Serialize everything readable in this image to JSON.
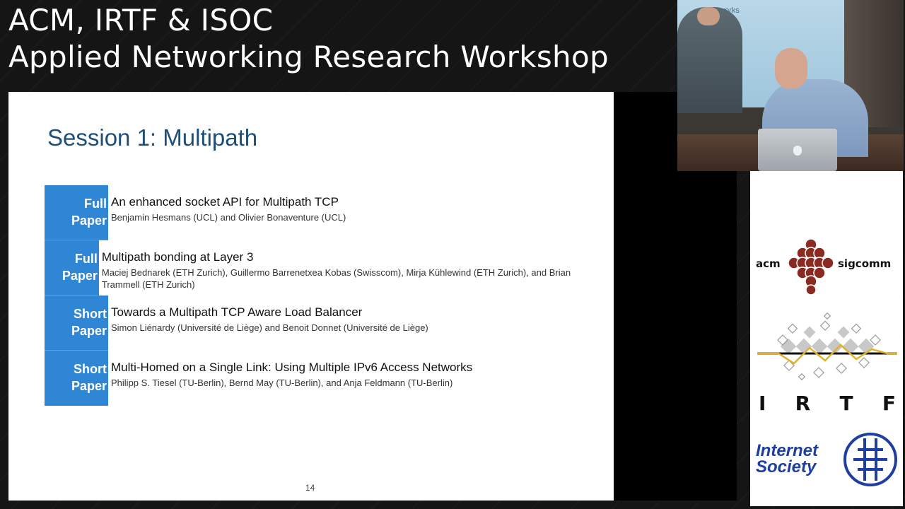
{
  "header": {
    "line1": "ACM, IRTF & ISOC",
    "line2": "Applied Networking Research Workshop"
  },
  "slide": {
    "title": "Session 1: Multipath",
    "page_number": "14",
    "sessions": [
      {
        "type_line1": "Full",
        "type_line2": "Paper",
        "title": "An enhanced socket API for Multipath TCP",
        "authors": "Benjamin Hesmans (UCL) and Olivier Bonaventure (UCL)"
      },
      {
        "type_line1": "Full",
        "type_line2": "Paper",
        "title": "Multipath bonding at Layer 3",
        "authors": "Maciej Bednarek (ETH Zurich), Guillermo Barrenetxea Kobas (Swisscom), Mirja Kühlewind (ETH Zurich), and Brian Trammell (ETH Zurich)"
      },
      {
        "type_line1": "Short",
        "type_line2": "Paper",
        "title": "Towards a Multipath TCP Aware Load Balancer",
        "authors": "Simon Liénardy (Université de Liège) and Benoit Donnet (Université de Liège)"
      },
      {
        "type_line1": "Short",
        "type_line2": "Paper",
        "title": "Multi-Homed on a Single Link: Using Multiple IPv6 Access Networks",
        "authors": "Philipp S. Tiesel (TU-Berlin), Bernd May (TU-Berlin), and Anja Feldmann (TU-Berlin)"
      }
    ]
  },
  "video": {
    "screen_text": "ss Networks"
  },
  "logos": {
    "acm_left": "acm",
    "acm_right": "sigcomm",
    "irtf_letters": [
      "I",
      "R",
      "T",
      "F"
    ],
    "isoc_line1": "Internet",
    "isoc_line2": "Society"
  },
  "colors": {
    "tag_blue": "#2f86d4",
    "slide_title": "#1d4e79",
    "acm_red": "#8a2b22",
    "isoc_blue": "#1e3ea0",
    "irtf_yellow": "#e0b224"
  }
}
